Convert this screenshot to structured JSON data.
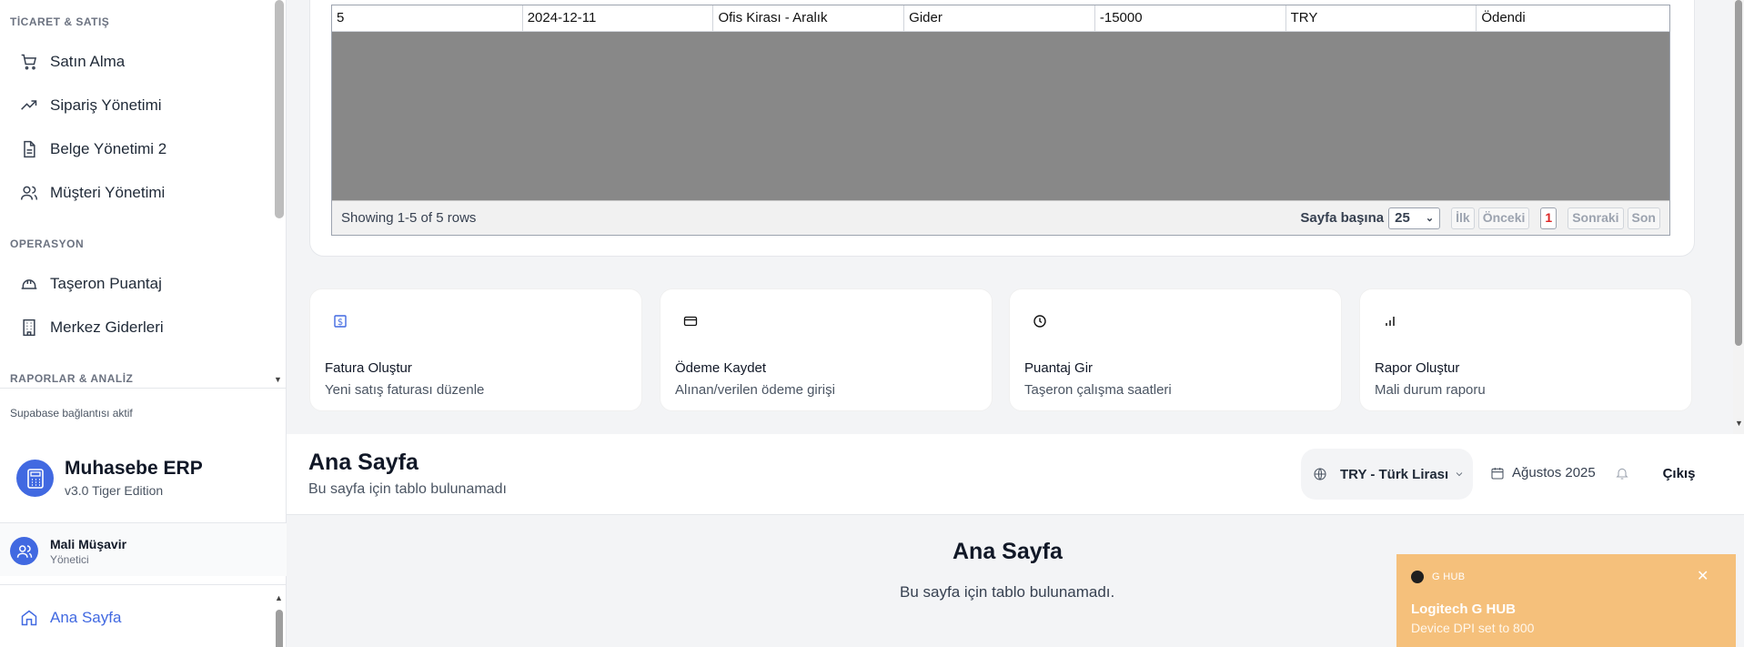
{
  "sidebar": {
    "sections": [
      {
        "title": "TİCARET & SATIŞ"
      },
      {
        "title": "OPERASYON"
      },
      {
        "title": "RAPORLAR & ANALİZ"
      }
    ],
    "items": [
      {
        "label": "Satın Alma",
        "icon": "cart-icon"
      },
      {
        "label": "Sipariş Yönetimi",
        "icon": "trending-up-icon"
      },
      {
        "label": "Belge Yönetimi 2",
        "icon": "document-icon"
      },
      {
        "label": "Müşteri Yönetimi",
        "icon": "users-icon"
      },
      {
        "label": "Taşeron Puantaj",
        "icon": "hard-hat-icon"
      },
      {
        "label": "Merkez Giderleri",
        "icon": "building-icon"
      }
    ],
    "status": "Supabase bağlantısı aktif",
    "brand": {
      "name": "Muhasebe ERP",
      "version": "v3.0 Tiger Edition"
    },
    "user": {
      "name": "Mali Müşavir",
      "role": "Yönetici"
    },
    "active_item": {
      "label": "Ana Sayfa",
      "icon": "home-icon"
    }
  },
  "table": {
    "rows": [
      [
        "5",
        "2024-12-11",
        "Ofis Kirası - Aralık",
        "Gider",
        "-15000",
        "TRY",
        "Ödendi"
      ]
    ],
    "footer_text": "Showing 1-5 of 5 rows",
    "per_page_label": "Sayfa başına",
    "per_page_value": "25",
    "pagination": {
      "first": "İlk",
      "prev": "Önceki",
      "current": "1",
      "next": "Sonraki",
      "last": "Son"
    }
  },
  "quick_actions": [
    {
      "title": "Fatura Oluştur",
      "subtitle": "Yeni satış faturası düzenle",
      "icon": "invoice-icon"
    },
    {
      "title": "Ödeme Kaydet",
      "subtitle": "Alınan/verilen ödeme girişi",
      "icon": "credit-card-icon"
    },
    {
      "title": "Puantaj Gir",
      "subtitle": "Taşeron çalışma saatleri",
      "icon": "clock-icon"
    },
    {
      "title": "Rapor Oluştur",
      "subtitle": "Mali durum raporu",
      "icon": "bar-chart-icon"
    }
  ],
  "header": {
    "title": "Ana Sayfa",
    "subtitle": "Bu sayfa için tablo bulunamadı",
    "currency": "TRY - Türk Lirası",
    "date": "Ağustos 2025",
    "logout": "Çıkış"
  },
  "content": {
    "title": "Ana Sayfa",
    "message": "Bu sayfa için tablo bulunamadı."
  },
  "toast": {
    "app": "G HUB",
    "title": "Logitech G HUB",
    "message": "Device DPI set to 800",
    "color": "#f5c07b"
  },
  "colors": {
    "accent": "#4169e1",
    "active_page": "#dc2626"
  }
}
